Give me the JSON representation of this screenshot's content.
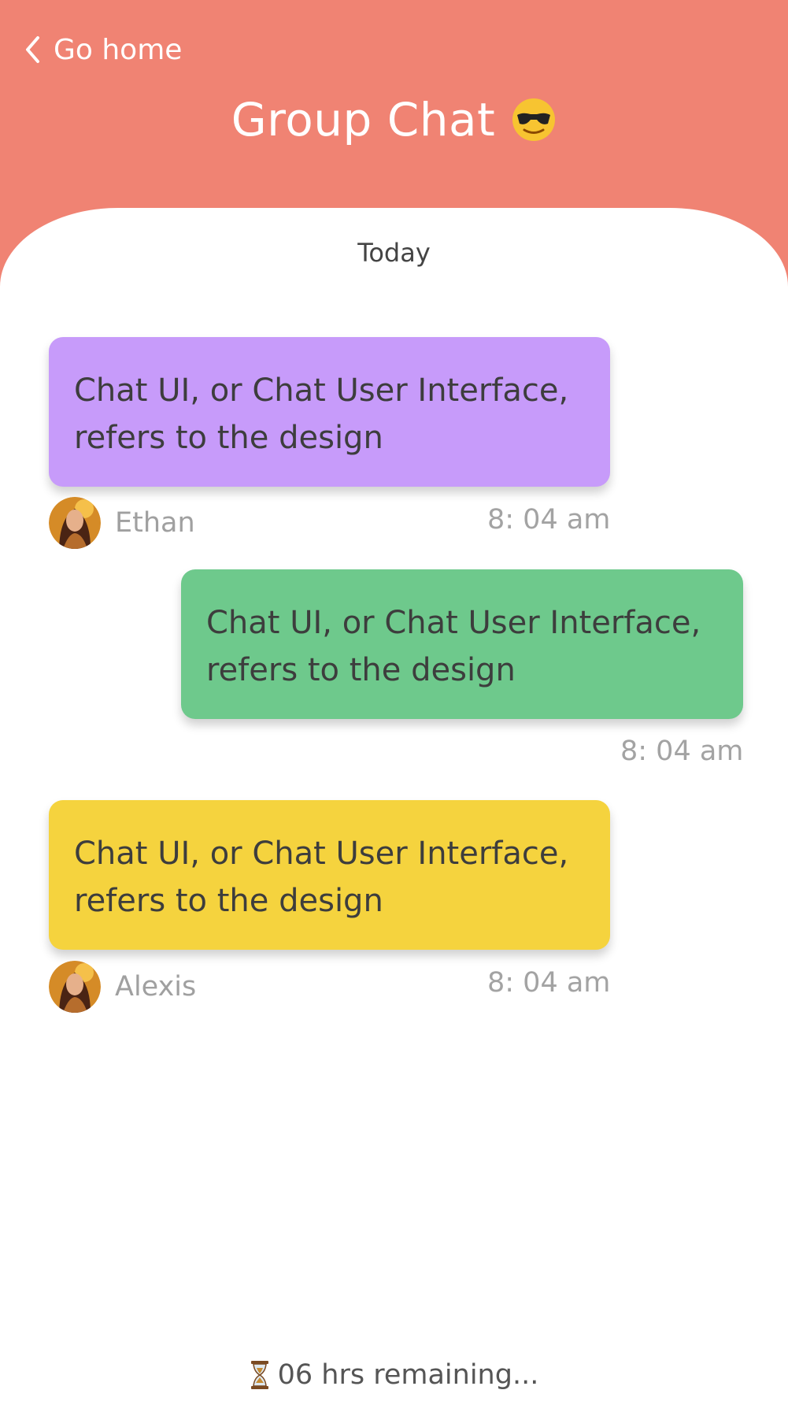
{
  "header": {
    "back_label": "Go home",
    "back_icon": "chevron-left-icon",
    "title": "Group Chat",
    "title_emoji_icon": "sunglasses-emoji-icon"
  },
  "chat": {
    "day_label": "Today",
    "messages": [
      {
        "text": "Chat UI, or Chat User Interface, refers to the design",
        "sender": "Ethan",
        "time": "8: 04 am",
        "bubble_color": "#c79bfa",
        "side": "left"
      },
      {
        "text": "Chat UI, or Chat User Interface, refers to the design",
        "sender": "",
        "time": "8: 04 am",
        "bubble_color": "#6ec98c",
        "side": "right"
      },
      {
        "text": "Chat UI, or Chat User Interface, refers to the design",
        "sender": "Alexis",
        "time": "8: 04 am",
        "bubble_color": "#f5d33e",
        "side": "left"
      }
    ]
  },
  "footer": {
    "icon": "hourglass-icon",
    "text": "06 hrs remaining..."
  },
  "colors": {
    "header_bg": "#f08373",
    "panel_bg": "#ffffff",
    "muted_text": "#a0a0a0"
  }
}
